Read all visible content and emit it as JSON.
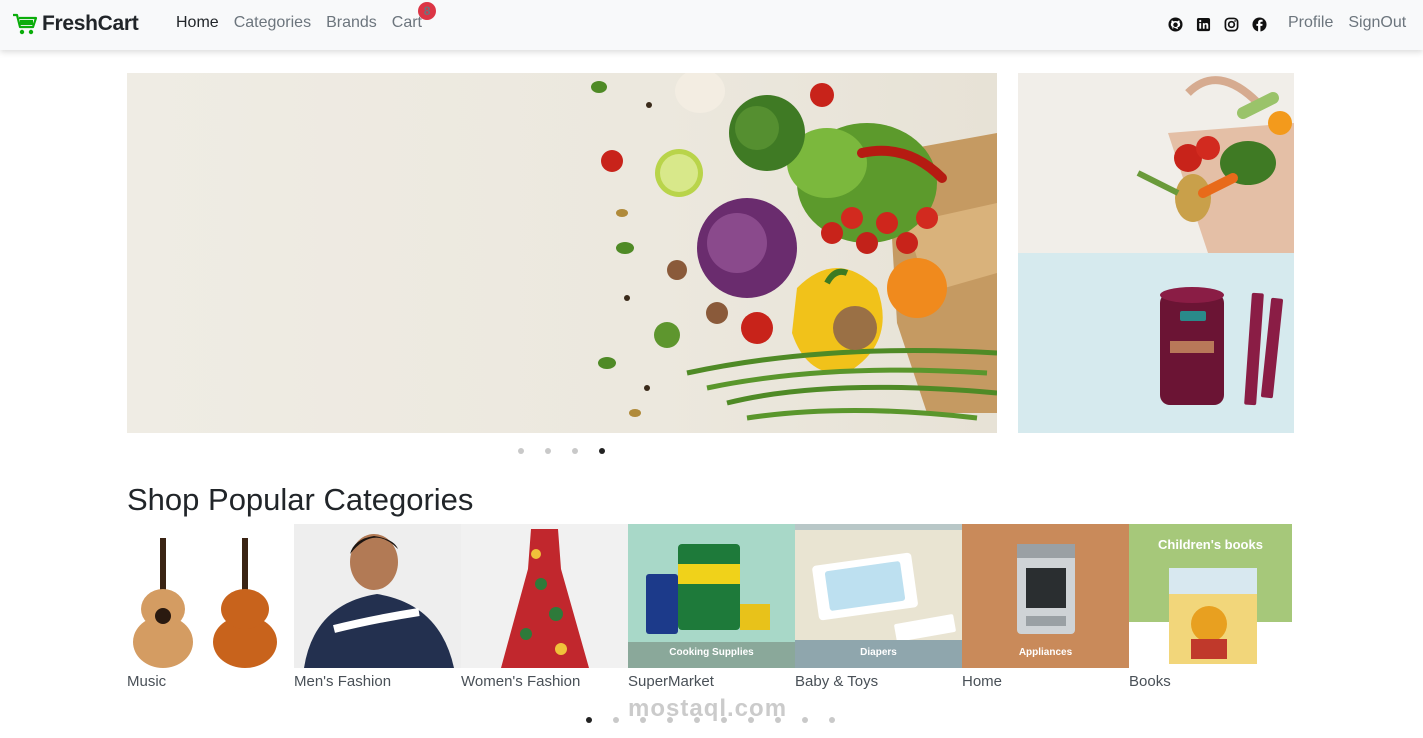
{
  "navbar": {
    "brand": "FreshCart",
    "links": [
      {
        "label": "Home",
        "active": true
      },
      {
        "label": "Categories",
        "active": false
      },
      {
        "label": "Brands",
        "active": false
      },
      {
        "label": "Cart",
        "active": false
      }
    ],
    "cart_count": "8",
    "social_icons": [
      "github-icon",
      "linkedin-icon",
      "instagram-icon",
      "facebook-icon"
    ],
    "right_links": [
      {
        "label": "Profile"
      },
      {
        "label": "SignOut"
      }
    ]
  },
  "hero": {
    "slides_count": 4,
    "active_slide": 4
  },
  "categories_section": {
    "title": "Shop Popular Categories",
    "items": [
      {
        "label": "Music",
        "caption": ""
      },
      {
        "label": "Men's Fashion",
        "caption": ""
      },
      {
        "label": "Women's Fashion",
        "caption": ""
      },
      {
        "label": "SuperMarket",
        "caption": "Cooking Supplies"
      },
      {
        "label": "Baby & Toys",
        "caption": "Diapers"
      },
      {
        "label": "Home",
        "caption": "Appliances"
      },
      {
        "label": "Books",
        "caption": "Children's books"
      }
    ],
    "dots_count": 10,
    "active_dot": 1
  },
  "watermark": {
    "text": "mostaql.com"
  },
  "colors": {
    "brand": "#0aad0a",
    "badge": "#dc3545",
    "navbar_bg": "#f8f9fa"
  }
}
